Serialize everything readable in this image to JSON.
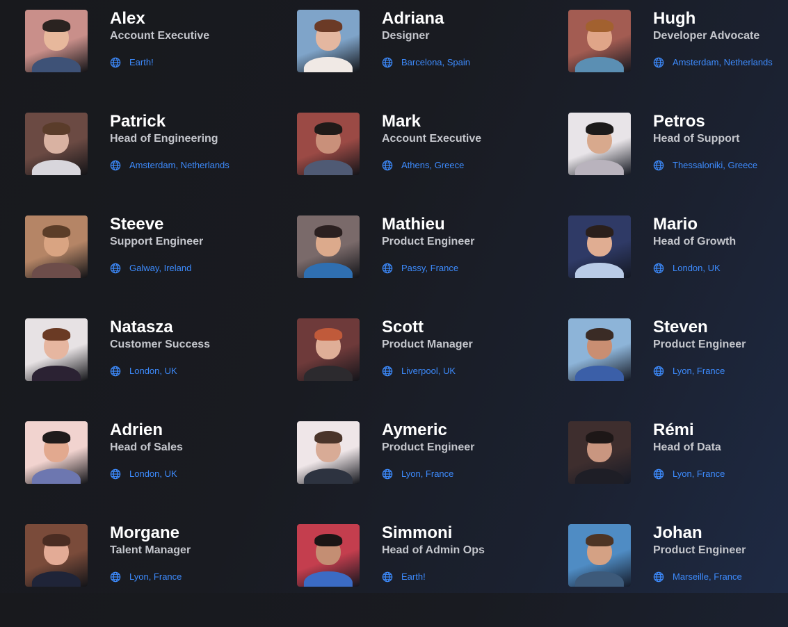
{
  "colors": {
    "background": "#191b21",
    "name": "#ffffff",
    "role": "#c4c6cc",
    "location": "#3d8bfd"
  },
  "location_icon": "globe-icon",
  "members": [
    {
      "name": "Alex",
      "role": "Account Executive",
      "location": "Earth!",
      "photo": {
        "bg": "#c98f8a",
        "skin": "#e7b89c",
        "hair": "#2a2320",
        "shirt": "#3e5277"
      }
    },
    {
      "name": "Adriana",
      "role": "Designer",
      "location": "Barcelona, Spain",
      "photo": {
        "bg": "#7fa4c9",
        "skin": "#e4b7a0",
        "hair": "#6b3a26",
        "shirt": "#f0e9e5"
      }
    },
    {
      "name": "Hugh",
      "role": "Developer Advocate",
      "location": "Amsterdam, Netherlands",
      "photo": {
        "bg": "#a35c52",
        "skin": "#e0a588",
        "hair": "#a2612f",
        "shirt": "#5b8fb3"
      }
    },
    {
      "name": "Patrick",
      "role": "Head of Engineering",
      "location": "Amsterdam, Netherlands",
      "photo": {
        "bg": "#6b4a43",
        "skin": "#d9b2a2",
        "hair": "#5a3c2a",
        "shirt": "#d8d6dc"
      }
    },
    {
      "name": "Mark",
      "role": "Account Executive",
      "location": "Athens, Greece",
      "photo": {
        "bg": "#9b4a45",
        "skin": "#c9907a",
        "hair": "#1f1a18",
        "shirt": "#4f5a74"
      }
    },
    {
      "name": "Petros",
      "role": "Head of Support",
      "location": "Thessaloniki, Greece",
      "photo": {
        "bg": "#e8e4e8",
        "skin": "#d8a98d",
        "hair": "#1c1a1a",
        "shirt": "#b9b3bd"
      }
    },
    {
      "name": "Steeve",
      "role": "Support Engineer",
      "location": "Galway, Ireland",
      "photo": {
        "bg": "#b58566",
        "skin": "#d9a482",
        "hair": "#5b3d28",
        "shirt": "#6d4d4a"
      }
    },
    {
      "name": "Mathieu",
      "role": "Product Engineer",
      "location": "Passy, France",
      "photo": {
        "bg": "#7a6a6a",
        "skin": "#dcaa8c",
        "hair": "#2b2020",
        "shirt": "#2f6fb1"
      }
    },
    {
      "name": "Mario",
      "role": "Head of Growth",
      "location": "London, UK",
      "photo": {
        "bg": "#2f3a66",
        "skin": "#e0ad92",
        "hair": "#2a1f1c",
        "shirt": "#b9cbe6"
      }
    },
    {
      "name": "Natasza",
      "role": "Customer Success",
      "location": "London, UK",
      "photo": {
        "bg": "#e7e2e4",
        "skin": "#e6b6a0",
        "hair": "#6a3a24",
        "shirt": "#2b2233"
      }
    },
    {
      "name": "Scott",
      "role": "Product Manager",
      "location": "Liverpool, UK",
      "photo": {
        "bg": "#6e3a3a",
        "skin": "#dfae97",
        "hair": "#c05a3a",
        "shirt": "#2c2a2e"
      }
    },
    {
      "name": "Steven",
      "role": "Product Engineer",
      "location": "Lyon, France",
      "photo": {
        "bg": "#8db4d8",
        "skin": "#c98e72",
        "hair": "#3a2b25",
        "shirt": "#3b5fa8"
      }
    },
    {
      "name": "Adrien",
      "role": "Head of Sales",
      "location": "London, UK",
      "photo": {
        "bg": "#f1d3cf",
        "skin": "#e2a98f",
        "hair": "#1f1b1b",
        "shirt": "#6d77b0"
      }
    },
    {
      "name": "Aymeric",
      "role": "Product Engineer",
      "location": "Lyon, France",
      "photo": {
        "bg": "#efe6e8",
        "skin": "#d8ab96",
        "hair": "#4a342a",
        "shirt": "#2d3340"
      }
    },
    {
      "name": "Rémi",
      "role": "Head of Data",
      "location": "Lyon, France",
      "photo": {
        "bg": "#3e2e2e",
        "skin": "#c99680",
        "hair": "#1d1717",
        "shirt": "#1e1e26"
      }
    },
    {
      "name": "Morgane",
      "role": "Talent Manager",
      "location": "Lyon, France",
      "photo": {
        "bg": "#7a4b3a",
        "skin": "#e3ab96",
        "hair": "#4a2c22",
        "shirt": "#1f2438"
      }
    },
    {
      "name": "Simmoni",
      "role": "Head of Admin Ops",
      "location": "Earth!",
      "photo": {
        "bg": "#c43e4e",
        "skin": "#c48e73",
        "hair": "#1b1515",
        "shirt": "#3b6bc4"
      }
    },
    {
      "name": "Johan",
      "role": "Product Engineer",
      "location": "Marseille, France",
      "photo": {
        "bg": "#4f8cc4",
        "skin": "#d4a184",
        "hair": "#4d3424",
        "shirt": "#3d5a7a"
      }
    }
  ]
}
